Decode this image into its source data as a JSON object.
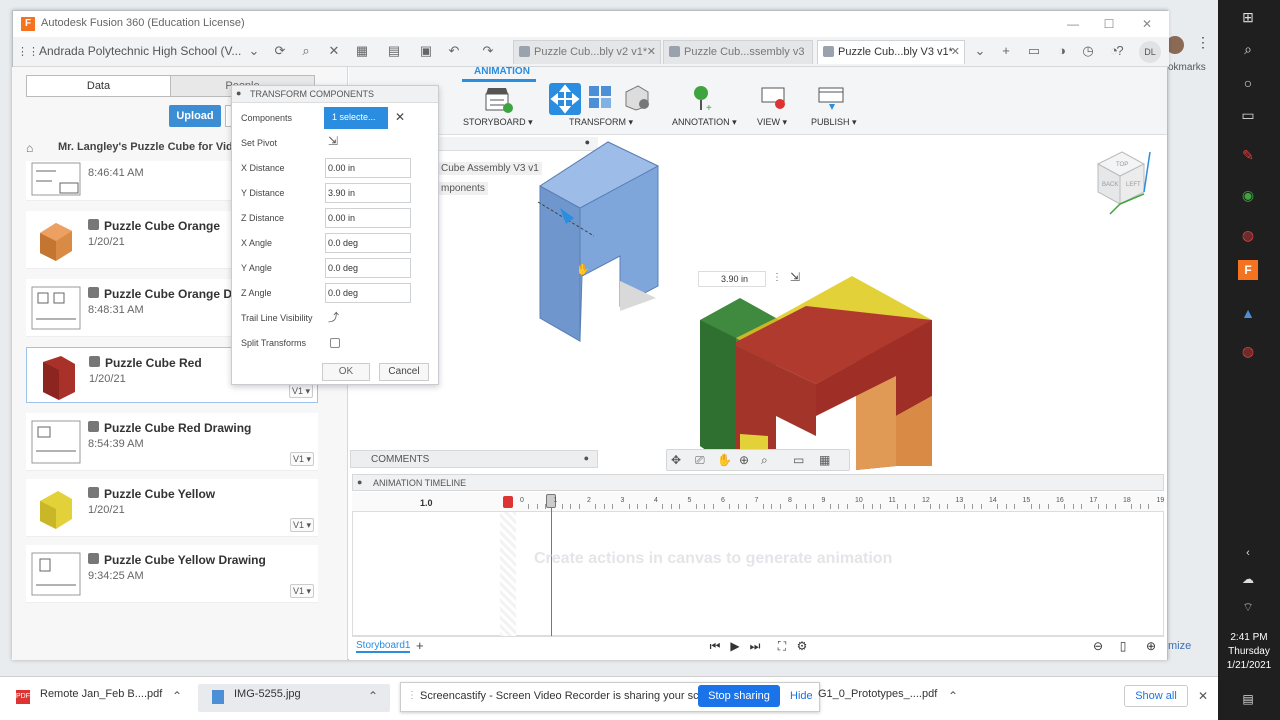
{
  "window": {
    "title": "Autodesk Fusion 360 (Education License)",
    "logo_letter": "F"
  },
  "toolbar": {
    "team": "Andrada Polytechnic High School (V...",
    "tabs": [
      {
        "label": "Puzzle Cub...bly v2 v1*"
      },
      {
        "label": "Puzzle Cub...ssembly v3"
      },
      {
        "label": "Puzzle Cub...bly V3 v1*"
      }
    ],
    "user_initials": "DL"
  },
  "data_panel": {
    "tab_data": "Data",
    "tab_people": "People",
    "upload": "Upload",
    "folder": "Mr. Langley's Puzzle Cube for Video",
    "items": [
      {
        "name": "",
        "date": "8:46:41 AM",
        "version": ""
      },
      {
        "name": "Puzzle Cube Orange",
        "date": "1/20/21",
        "version": ""
      },
      {
        "name": "Puzzle Cube Orange Dra",
        "date": "8:48:31 AM",
        "version": ""
      },
      {
        "name": "Puzzle Cube Red",
        "date": "1/20/21",
        "version": "V1 ▾"
      },
      {
        "name": "Puzzle Cube Red Drawing",
        "date": "8:54:39 AM",
        "version": "V1 ▾"
      },
      {
        "name": "Puzzle Cube Yellow",
        "date": "1/20/21",
        "version": "V1 ▾"
      },
      {
        "name": "Puzzle Cube Yellow Drawing",
        "date": "9:34:25 AM",
        "version": "V1 ▾"
      }
    ]
  },
  "ribbon": {
    "workspace": "ANIMATION",
    "groups": [
      "STORYBOARD ▾",
      "TRANSFORM ▾",
      "ANNOTATION ▾",
      "VIEW ▾",
      "PUBLISH ▾"
    ]
  },
  "browser": {
    "item1": "Cube Assembly V3 v1",
    "item2": "mponents"
  },
  "transform_dialog": {
    "title": "TRANSFORM COMPONENTS",
    "components_label": "Components",
    "components_value": "1 selecte...",
    "set_pivot": "Set Pivot",
    "x_distance_label": "X Distance",
    "x_distance": "0.00 in",
    "y_distance_label": "Y Distance",
    "y_distance": "3.90 in",
    "z_distance_label": "Z Distance",
    "z_distance": "0.00 in",
    "x_angle_label": "X Angle",
    "x_angle": "0.0 deg",
    "y_angle_label": "Y Angle",
    "y_angle": "0.0 deg",
    "z_angle_label": "Z Angle",
    "z_angle": "0.0 deg",
    "trail_label": "Trail Line Visibility",
    "split_label": "Split Transforms",
    "ok": "OK",
    "cancel": "Cancel"
  },
  "canvas": {
    "manipulator_value": "3.90 in",
    "comments": "COMMENTS",
    "animation_timeline": "ANIMATION TIMELINE",
    "speed": "1.0",
    "ruler_ticks": [
      "0",
      "1",
      "2",
      "3",
      "4",
      "5",
      "6",
      "7",
      "8",
      "9",
      "10",
      "11",
      "12",
      "13",
      "14",
      "15",
      "16",
      "17",
      "18",
      "19"
    ],
    "hint": "Create actions in canvas to generate animation",
    "storyboard_tab": "Storyboard1",
    "viewcube": {
      "top": "TOP",
      "back": "BACK",
      "left": "LEFT"
    }
  },
  "browser_chrome": {
    "bookmarks": "okmarks",
    "minimize_text": "mize"
  },
  "taskbar": {
    "time": "2:41 PM",
    "day": "Thursday",
    "date": "1/21/2021"
  },
  "downloads": {
    "items": [
      {
        "name": "Remote Jan_Feb B....pdf"
      },
      {
        "name": "IMG-5255.jpg"
      },
      {
        "name": "G1_0_Prototypes_....pdf"
      }
    ],
    "screencastify_text": "Screencastify - Screen Video Recorder is sharing your screen.",
    "stop_sharing": "Stop sharing",
    "hide": "Hide",
    "show_all": "Show all"
  },
  "colors": {
    "accent": "#2a8de0",
    "selected_part": "#7ea6db",
    "red": "#b03a2e",
    "green": "#3f8a3f",
    "yellow": "#e3d13a",
    "orange": "#d98a44"
  }
}
